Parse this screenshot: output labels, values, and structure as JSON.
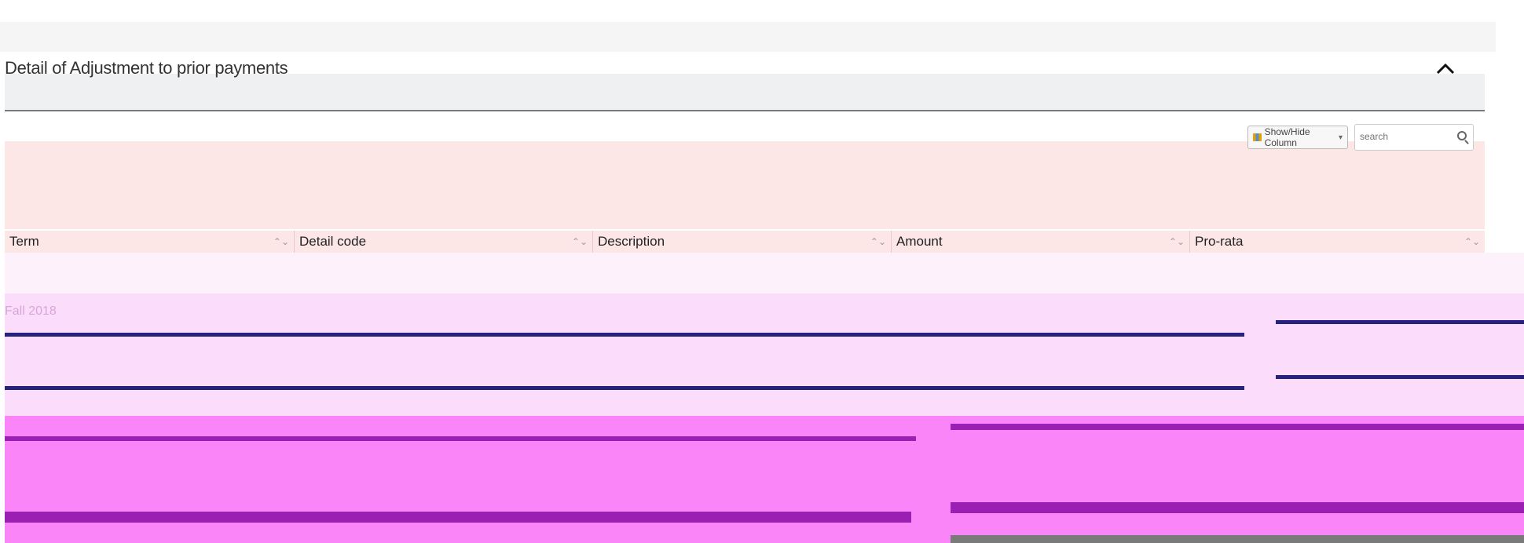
{
  "panel": {
    "title": "Detail of Adjustment to prior payments"
  },
  "toolbar": {
    "show_hide_label": "Show/Hide Column",
    "search_placeholder": "search"
  },
  "table": {
    "columns": [
      "Term",
      "Detail code",
      "Description",
      "Amount",
      "Pro-rata"
    ],
    "rows": [
      {
        "term": "Fall 2018"
      }
    ]
  },
  "icons": {
    "collapse": "chevron-up-icon",
    "search": "search-icon",
    "dropdown": "caret-down-icon",
    "sort": "sort-icon"
  },
  "colors": {
    "header_band": "#fde6e6",
    "row_line": "#24247f",
    "lower_magenta": "#f985f9",
    "lower_purple": "#9b1fb3"
  }
}
